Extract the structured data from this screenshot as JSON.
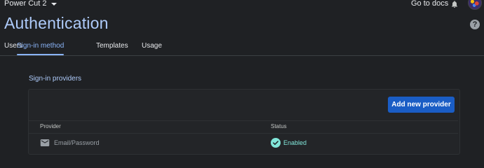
{
  "header": {
    "project_name": "Power Cut 2",
    "docs_link": "Go to docs",
    "icons": {
      "dropdown": "chevron-down-icon",
      "notifications": "bell-icon",
      "avatar": "user-avatar",
      "help": "help-icon"
    }
  },
  "page": {
    "title": "Authentication",
    "help_symbol": "?"
  },
  "tabs": [
    {
      "label": "Users",
      "active": false
    },
    {
      "label": "Sign-in method",
      "active": true
    },
    {
      "label": "Templates",
      "active": false
    },
    {
      "label": "Usage",
      "active": false
    }
  ],
  "providers": {
    "section_title": "Sign-in providers",
    "add_button": "Add new provider",
    "columns": {
      "provider": "Provider",
      "status": "Status"
    },
    "rows": [
      {
        "icon": "mail-icon",
        "name": "Email/Password",
        "status_icon": "check-circle-icon",
        "status": "Enabled"
      }
    ]
  },
  "colors": {
    "background": "#1f2124",
    "accent": "#8ab4f8",
    "title": "#aecbfa",
    "button": "#1a5dc5",
    "enabled": "#81e6d9"
  }
}
